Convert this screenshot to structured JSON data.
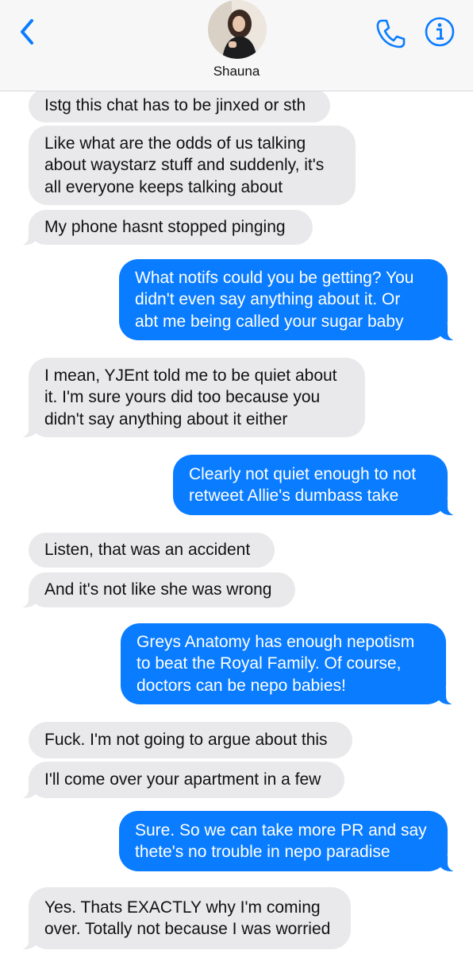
{
  "header": {
    "contact_name": "Shauna",
    "back_icon": "chevron-left-icon",
    "call_icon": "phone-icon",
    "info_icon": "info-icon",
    "accent_color": "#0a7cff"
  },
  "messages": [
    {
      "sender": "contact",
      "text": "Istg this chat has to be jinxed or sth"
    },
    {
      "sender": "contact",
      "text": "Like what are the odds of us talking\nabout waystarz stuff and suddenly, it's\nall everyone keeps talking about"
    },
    {
      "sender": "contact",
      "text": "My phone hasnt stopped pinging"
    },
    {
      "sender": "me",
      "text": "What notifs could you be getting? You\ndidn't even say anything about it. Or\nabt me being called your sugar baby"
    },
    {
      "sender": "contact",
      "text": "I mean, YJEnt told me to be quiet about\nit. I'm sure yours did too because you\ndidn't say anything about it either"
    },
    {
      "sender": "me",
      "text": "Clearly not quiet enough to not\nretweet Allie's dumbass take"
    },
    {
      "sender": "contact",
      "text": "Listen, that was an accident"
    },
    {
      "sender": "contact",
      "text": "And it's not like she was wrong"
    },
    {
      "sender": "me",
      "text": "Greys Anatomy has enough nepotism\nto beat the Royal Family. Of course,\ndoctors can be nepo babies!"
    },
    {
      "sender": "contact",
      "text": "Fuck. I'm not going to argue about this"
    },
    {
      "sender": "contact",
      "text": "I'll come over your apartment in a few"
    },
    {
      "sender": "me",
      "text": "Sure. So we can take more PR and say\nthete's no trouble in nepo paradise"
    },
    {
      "sender": "contact",
      "text": "Yes. Thats EXACTLY why I'm coming\nover. Totally not because I was worried"
    }
  ]
}
